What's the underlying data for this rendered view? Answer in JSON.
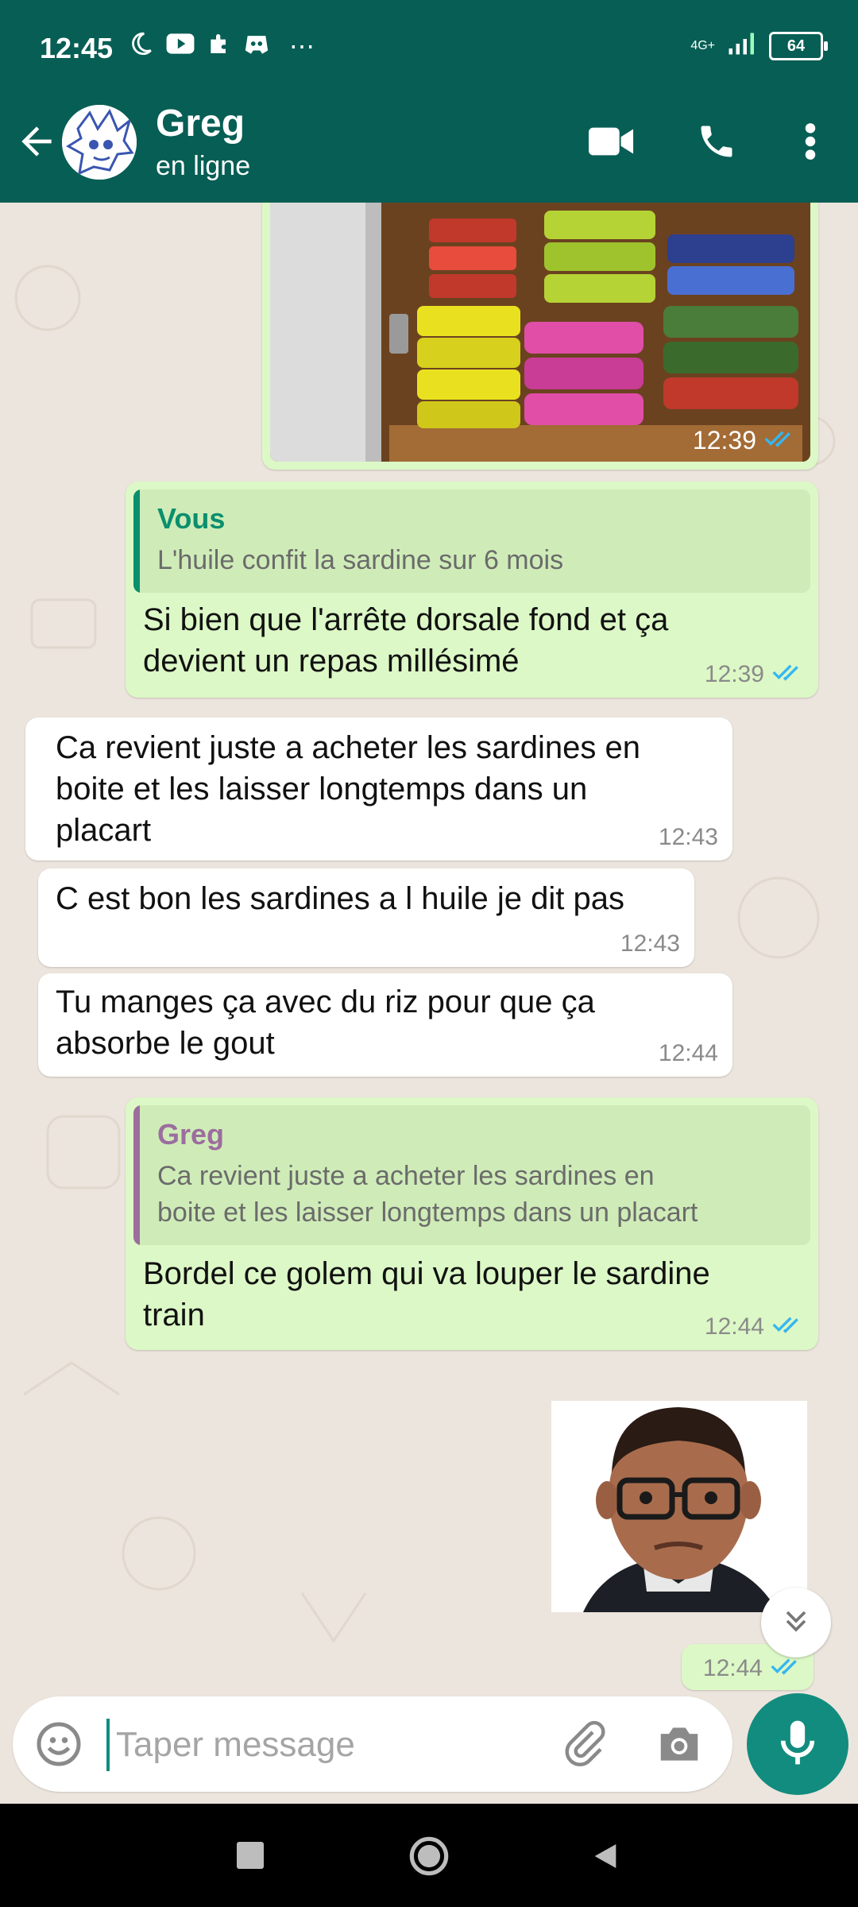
{
  "status_bar": {
    "time": "12:45",
    "network": "4G+",
    "battery": "64"
  },
  "header": {
    "name": "Greg",
    "status": "en ligne"
  },
  "messages": [
    {
      "type": "image",
      "direction": "out",
      "time": "12:39",
      "description": "sardine-cans-cupboard-photo"
    },
    {
      "type": "reply",
      "direction": "out",
      "quote_author": "Vous",
      "quote_text": "L'huile confit la sardine sur 6 mois",
      "text_line1": "Si bien que l'arrête dorsale fond et ça",
      "text_line2": "devient un repas millésimé",
      "time": "12:39"
    },
    {
      "type": "text",
      "direction": "in",
      "text_line1": "Ca revient juste a acheter les sardines en",
      "text_line2": "boite et les laisser longtemps dans un",
      "text_line3": "placart",
      "time": "12:43"
    },
    {
      "type": "text",
      "direction": "in",
      "text_line1": "C est bon les sardines a l huile je dit pas",
      "time": "12:43"
    },
    {
      "type": "text",
      "direction": "in",
      "text_line1": "Tu manges ça avec du riz pour que ça",
      "text_line2": "absorbe le gout",
      "time": "12:44"
    },
    {
      "type": "reply",
      "direction": "out",
      "quote_author": "Greg",
      "quote_text_line1": "Ca revient juste a acheter les sardines en",
      "quote_text_line2": "boite et les laisser longtemps dans un placart",
      "text_line1": "Bordel ce golem qui va louper le sardine",
      "text_line2": "train",
      "time": "12:44"
    },
    {
      "type": "sticker",
      "direction": "out",
      "time": "12:44",
      "description": "man-with-glasses-sticker"
    }
  ],
  "composer": {
    "placeholder": "Taper message"
  },
  "colors": {
    "header": "#075E54",
    "accent": "#128C7E",
    "outgoing_bubble": "#DCF8C6",
    "incoming_bubble": "#FFFFFF",
    "read_ticks": "#34B7F1",
    "quote_vous": "#0B8F6E",
    "quote_greg": "#9C6D9E"
  },
  "icons": [
    "back-arrow-icon",
    "video-call-icon",
    "phone-icon",
    "more-vert-icon",
    "emoji-icon",
    "attach-icon",
    "camera-icon",
    "mic-icon",
    "double-check-icon",
    "chevron-down-double-icon"
  ]
}
